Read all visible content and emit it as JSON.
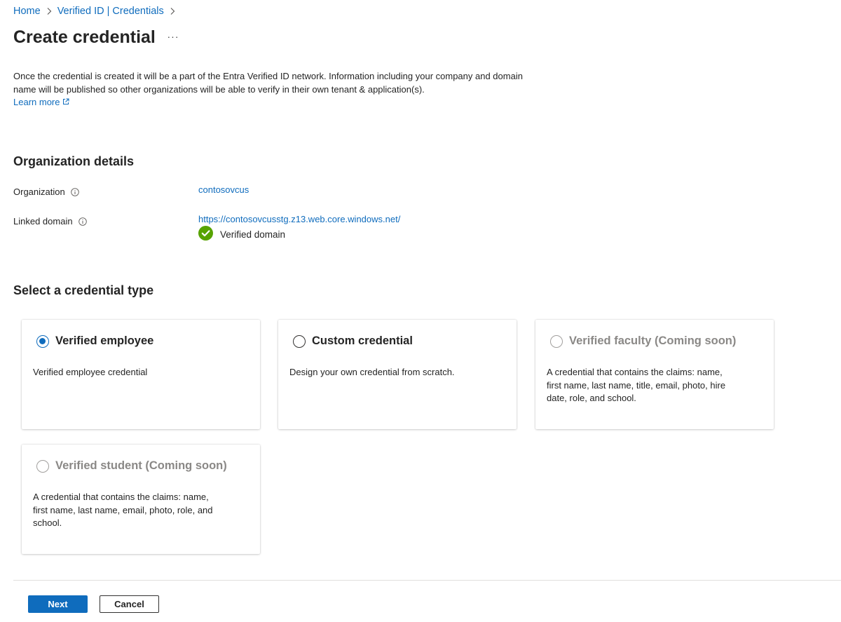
{
  "breadcrumb": {
    "items": [
      "Home",
      "Verified ID | Credentials"
    ]
  },
  "page": {
    "title": "Create credential",
    "more_label": "···"
  },
  "intro": {
    "text": "Once the credential is created it will be a part of the Entra Verified ID network. Information including your company and domain name will be published so other organizations will be able to verify in their own tenant & application(s).",
    "learn_more": "Learn more"
  },
  "organization_details": {
    "title": "Organization details",
    "organization_label": "Organization",
    "organization_value": "contosovcus",
    "linked_domain_label": "Linked domain",
    "linked_domain_value": "https://contosovcusstg.z13.web.core.windows.net/",
    "verified_label": "Verified domain"
  },
  "credential_type": {
    "title": "Select a credential type",
    "cards": [
      {
        "title": "Verified employee",
        "description": "Verified employee credential",
        "selected": true,
        "disabled": false
      },
      {
        "title": "Custom credential",
        "description": "Design your own credential from scratch.",
        "selected": false,
        "disabled": false
      },
      {
        "title": "Verified faculty (Coming soon)",
        "description": "A credential that contains the claims: name, first name, last name, title, email, photo, hire date, role, and school.",
        "selected": false,
        "disabled": true
      },
      {
        "title": "Verified student (Coming soon)",
        "description": "A credential that contains the claims: name, first name, last name, email, photo, role, and school.",
        "selected": false,
        "disabled": true
      }
    ]
  },
  "footer": {
    "next_label": "Next",
    "cancel_label": "Cancel"
  },
  "colors": {
    "accent": "#0f6cbd",
    "success": "#57a300"
  },
  "icons": {
    "info": "info-icon",
    "external": "external-link-icon",
    "check": "check-circle-icon",
    "chevron": "chevron-right-icon"
  }
}
